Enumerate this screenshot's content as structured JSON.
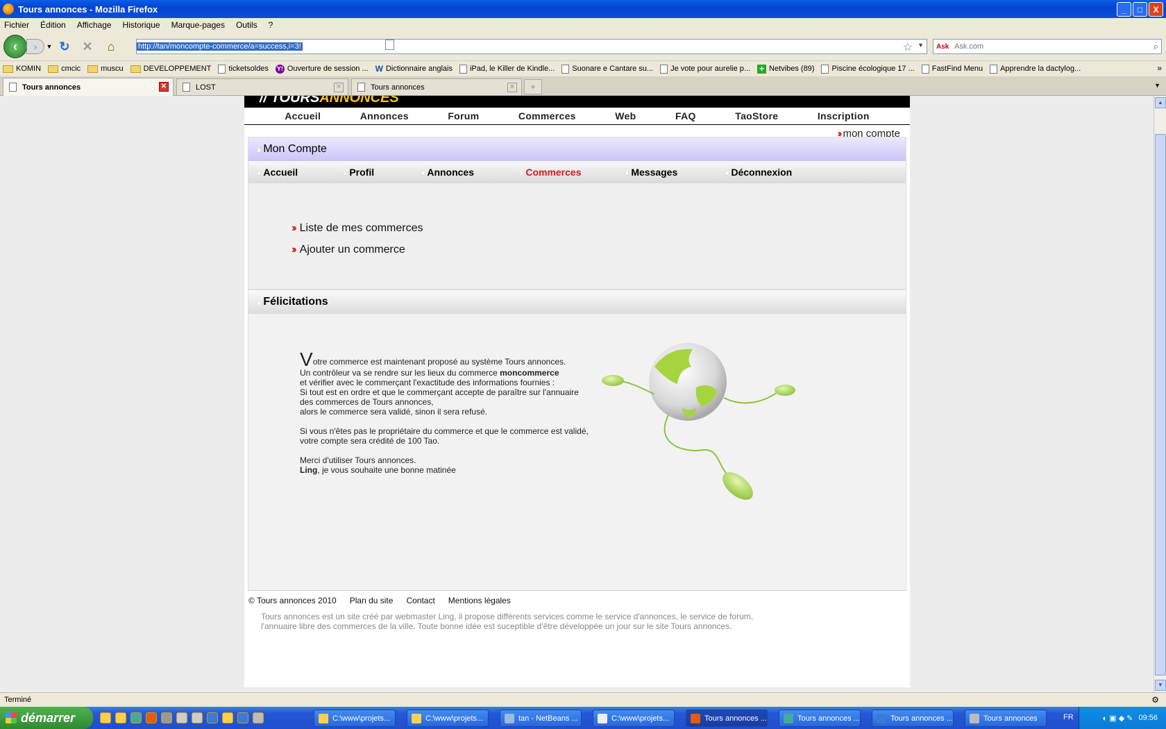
{
  "window": {
    "title": "Tours annonces - Mozilla Firefox",
    "minimize": "_",
    "maximize": "□",
    "close": "X"
  },
  "menu": [
    "Fichier",
    "Édition",
    "Affichage",
    "Historique",
    "Marque-pages",
    "Outils",
    "?"
  ],
  "nav": {
    "url": "http://tan/moncompte-commerce/a=success,i=3!",
    "search_placeholder": "Ask.com",
    "search_engine": "Ask"
  },
  "bookmarks": [
    {
      "label": "KOMIN",
      "icon": "folder"
    },
    {
      "label": "cmcic",
      "icon": "folder"
    },
    {
      "label": "muscu",
      "icon": "folder"
    },
    {
      "label": "DEVELOPPEMENT",
      "icon": "folder"
    },
    {
      "label": "ticketsoldes",
      "icon": "page"
    },
    {
      "label": "Ouverture de session ...",
      "icon": "yahoo"
    },
    {
      "label": "Dictionnaire anglais",
      "icon": "wr"
    },
    {
      "label": "iPad, le Killer de Kindle...",
      "icon": "page"
    },
    {
      "label": "Suonare e Cantare su...",
      "icon": "page"
    },
    {
      "label": "Je vote pour aurelie p...",
      "icon": "page"
    },
    {
      "label": "Netvibes (89)",
      "icon": "netvibes"
    },
    {
      "label": "Piscine écologique 17 ...",
      "icon": "page"
    },
    {
      "label": "FastFind Menu",
      "icon": "page"
    },
    {
      "label": "Apprendre la dactylog...",
      "icon": "page"
    }
  ],
  "tabs": [
    {
      "label": "Tours annonces",
      "active": true
    },
    {
      "label": "LOST",
      "active": false
    },
    {
      "label": "Tours annonces",
      "active": false
    }
  ],
  "site": {
    "main_nav": [
      "Accueil",
      "Annonces",
      "Forum",
      "Commerces",
      "Web",
      "FAQ",
      "TaoStore",
      "Inscription"
    ],
    "mon_compte": "mon compte",
    "panel_title": "Mon Compte",
    "sub_nav": [
      {
        "label": "Accueil",
        "active": false
      },
      {
        "label": "Profil",
        "active": false
      },
      {
        "label": "Annonces",
        "active": false
      },
      {
        "label": "Commerces",
        "active": true
      },
      {
        "label": "Messages",
        "active": false
      },
      {
        "label": "Déconnexion",
        "active": false
      }
    ],
    "actions": [
      "Liste de mes commerces",
      "Ajouter un commerce"
    ],
    "felicitations": {
      "title": "Félicitations",
      "first_letter": "V",
      "line1_rest": "otre commerce est maintenant proposé au système Tours annonces.",
      "line2_pre": "Un contrôleur va se rendre sur les lieux du commerce ",
      "line2_bold": "moncommerce",
      "line3": "et vérifier avec le commerçant l'exactitude des informations fournies :",
      "line4": "Si tout est en ordre et que le commerçant accepte de paraître sur l'annuaire",
      "line5": "des commerces de Tours annonces,",
      "line6": "alors le commerce sera validé, sinon il sera refusé.",
      "line7": "Si vous n'êtes pas le propriétaire du commerce et que le commerce est validé,",
      "line8": "votre compte sera crédité de 100 Tao.",
      "line9": "Merci d'utiliser Tours annonces.",
      "line10_bold": "Ling",
      "line10_rest": ", je vous souhaite une bonne matinée"
    },
    "footer": {
      "copyright": "© Tours annonces 2010",
      "links": [
        "Plan du site",
        "Contact",
        "Mentions légales"
      ],
      "text": "Tours annonces est un site créé par webmaster Ling, il propose différents services comme le service d'annonces, le service de forum, l'annuaire libre des commerces de la ville. Toute bonne idée est suceptible d'être développée un jour sur le site Tours annonces."
    }
  },
  "status": "Terminé",
  "taskbar": {
    "start": "démarrer",
    "buttons": [
      "C:\\www\\projets...",
      "C:\\www\\projets...",
      "tan - NetBeans ...",
      "C:\\www\\projets...",
      "Tours annonces ...",
      "Tours annonces ...",
      "Tours annonces ...",
      "Tours annonces"
    ],
    "active_index": 4,
    "lang": "FR",
    "clock": "09:56"
  }
}
